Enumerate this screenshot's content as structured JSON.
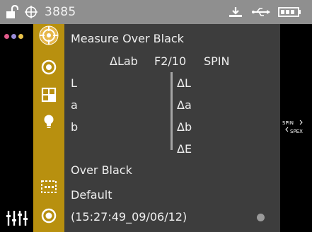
{
  "status": {
    "serial": "3885",
    "icons": [
      "lock-open-icon",
      "target-icon",
      "dock-icon",
      "usb-icon",
      "battery-icon"
    ]
  },
  "panel": {
    "title": "Measure Over Black",
    "mode": "ΔLab",
    "illuminant": "F2/10",
    "specular": "SPIN",
    "row_labels": [
      "L",
      "a",
      "b"
    ],
    "delta_labels": [
      "ΔL",
      "Δa",
      "Δb",
      "ΔE"
    ],
    "over_black": "Over Black",
    "standard_name": "Default",
    "timestamp": "(15:27:49_09/06/12)"
  },
  "sidebar": {
    "tabs": [
      "measure-tab",
      "target-tab",
      "grid-tab",
      "lightbulb-tab",
      "bracket-tab",
      "record-tab"
    ]
  },
  "right": {
    "spin_label": "SPIN",
    "spex_label": "SPEX"
  },
  "colors": {
    "accent_gold": "#b8900f",
    "panel_bg": "#3d3d3d",
    "status_bg": "#8f8f8f"
  }
}
